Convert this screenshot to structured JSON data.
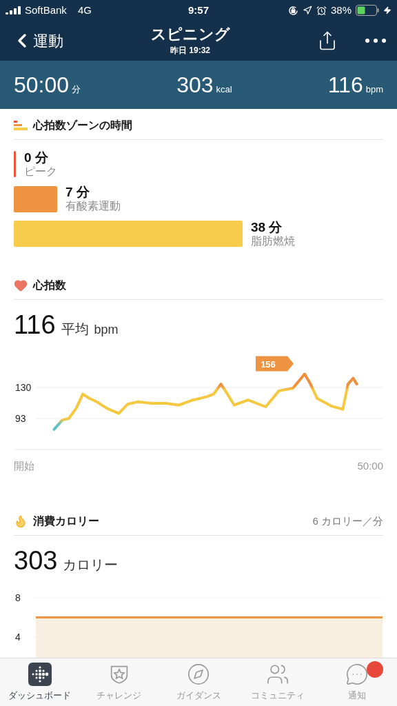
{
  "status_bar": {
    "carrier": "SoftBank",
    "network": "4G",
    "time": "9:57",
    "battery": "38%"
  },
  "nav": {
    "back": "運動",
    "title": "スピニング",
    "subtitle": "昨日 19:32"
  },
  "summary": [
    {
      "value": "50:00",
      "unit": "分"
    },
    {
      "value": "303",
      "unit": "kcal"
    },
    {
      "value": "116",
      "unit": "bpm"
    }
  ],
  "zones": {
    "title": "心拍数ゾーンの時間",
    "items": [
      {
        "minutes": "0 分",
        "label": "ピーク",
        "color": "#e8553a"
      },
      {
        "minutes": "7 分",
        "label": "有酸素運動",
        "color": "#ee9440"
      },
      {
        "minutes": "38 分",
        "label": "脂肪燃焼",
        "color": "#f6cc4a"
      }
    ]
  },
  "heart_rate": {
    "title": "心拍数",
    "average": "116",
    "average_label": "平均",
    "unit": "bpm",
    "y_tick_labels": [
      "130",
      "93"
    ],
    "peak_label": "156",
    "start_label": "開始",
    "end_label": "50:00"
  },
  "calories": {
    "title": "消費カロリー",
    "rate": "6 カロリー／分",
    "total": "303",
    "unit": "カロリー",
    "y_tick_labels": [
      "8",
      "4"
    ]
  },
  "tabs": [
    {
      "label": "ダッシュボード",
      "selected": true,
      "badge": false
    },
    {
      "label": "チャレンジ",
      "selected": false,
      "badge": false
    },
    {
      "label": "ガイダンス",
      "selected": false,
      "badge": false
    },
    {
      "label": "コミュニティ",
      "selected": false,
      "badge": false
    },
    {
      "label": "通知",
      "selected": false,
      "badge": true
    }
  ]
}
